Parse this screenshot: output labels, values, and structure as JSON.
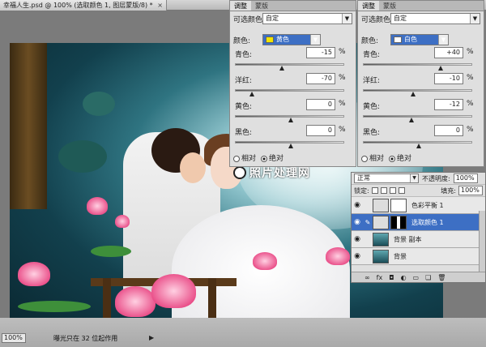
{
  "document": {
    "tab_title": "幸福人生.psd @ 100% (选取颜色 1, 图层蒙版/8) *",
    "close_symbol": "×"
  },
  "panel_left": {
    "tabs": [
      "调整",
      "蒙版"
    ],
    "preset_label": "可选颜色",
    "preset_value": "自定",
    "color_label": "颜色:",
    "color_value": "黄色",
    "color_swatch": "#f2e600",
    "sliders": [
      {
        "name": "青色:",
        "value": "-15",
        "unit": "%",
        "level": -15
      },
      {
        "name": "洋红:",
        "value": "-70",
        "unit": "%",
        "level": -70
      },
      {
        "name": "黄色:",
        "value": "0",
        "unit": "%",
        "level": 0
      },
      {
        "name": "黑色:",
        "value": "0",
        "unit": "%",
        "level": 0
      }
    ],
    "radio_relative": "相对",
    "radio_absolute": "绝对"
  },
  "panel_right": {
    "tabs": [
      "调整",
      "蒙版"
    ],
    "preset_label": "可选颜色",
    "preset_value": "自定",
    "color_label": "颜色:",
    "color_value": "白色",
    "color_swatch": "#ffffff",
    "sliders": [
      {
        "name": "青色:",
        "value": "+40",
        "unit": "%",
        "level": 40
      },
      {
        "name": "洋红:",
        "value": "-10",
        "unit": "%",
        "level": -10
      },
      {
        "name": "黄色:",
        "value": "-12",
        "unit": "%",
        "level": -12
      },
      {
        "name": "黑色:",
        "value": "0",
        "unit": "%",
        "level": 0
      }
    ],
    "radio_relative": "相对",
    "radio_absolute": "绝对"
  },
  "watermark": {
    "text": "照片处理网"
  },
  "layers": {
    "blend_mode": "正常",
    "opacity_label": "不透明度:",
    "opacity_value": "100%",
    "lock_label": "锁定:",
    "fill_label": "填充:",
    "fill_value": "100%",
    "items": [
      {
        "name": "色彩平衡 1",
        "selected": false
      },
      {
        "name": "选取颜色 1",
        "selected": true
      },
      {
        "name": "背景 副本",
        "selected": false
      },
      {
        "name": "背景",
        "selected": false
      }
    ],
    "bottom_icons": [
      "fx"
    ]
  },
  "status": {
    "zoom": "100%",
    "message": "曝光只在 32 位起作用"
  }
}
